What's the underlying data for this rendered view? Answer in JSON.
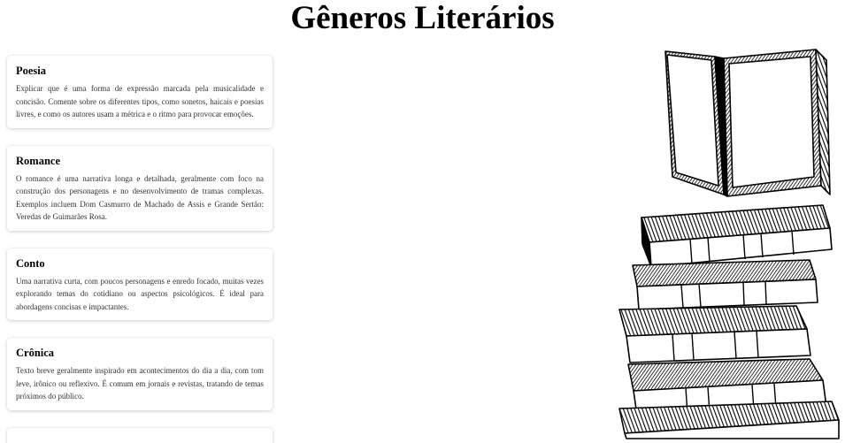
{
  "page": {
    "title": "Gêneros Literários"
  },
  "genres": [
    {
      "title": "Poesia",
      "description": "Explicar que é uma forma de expressão marcada pela musicalidade e concisão. Comente sobre os diferentes tipos, como sonetos, haicais e poesias livres, e como os autores usam a métrica e o ritmo para provocar emoções."
    },
    {
      "title": "Romance",
      "description": "O romance é uma narrativa longa e detalhada, geralmente com foco na construção dos personagens e no desenvolvimento de tramas complexas. Exemplos incluem Dom Casmurro de Machado de Assis e Grande Sertão: Veredas de Guimarães Rosa."
    },
    {
      "title": "Conto",
      "description": "Uma narrativa curta, com poucos personagens e enredo focado, muitas vezes explorando temas do cotidiano ou aspectos psicológicos. É ideal para abordagens concisas e impactantes."
    },
    {
      "title": "Crônica",
      "description": "Texto breve geralmente inspirado em acontecimentos do dia a dia, com tom leve, irônico ou reflexivo. É comum em jornais e revistas, tratando de temas próximos do público."
    }
  ],
  "illustration": {
    "icon": "stack-of-books-icon",
    "ink_color": "#000000"
  }
}
